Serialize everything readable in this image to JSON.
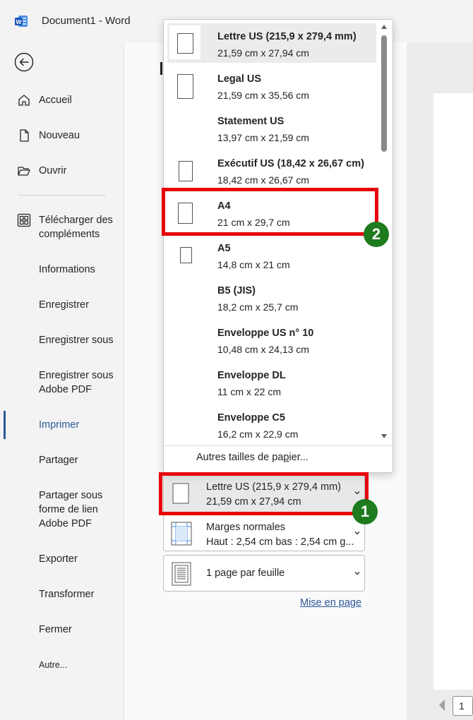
{
  "app": {
    "title": "Document1  -  Word",
    "logo_letter": "W"
  },
  "sidebar": {
    "items": [
      {
        "label": "Accueil",
        "icon": "home-icon"
      },
      {
        "label": "Nouveau",
        "icon": "new-document-icon"
      },
      {
        "label": "Ouvrir",
        "icon": "folder-open-icon"
      },
      {
        "label": "Télécharger des compléments",
        "icon": "add-ins-icon"
      },
      {
        "label": "Informations"
      },
      {
        "label": "Enregistrer"
      },
      {
        "label": "Enregistrer sous"
      },
      {
        "label": "Enregistrer sous Adobe PDF"
      },
      {
        "label": "Imprimer",
        "active": true
      },
      {
        "label": "Partager"
      },
      {
        "label": "Partager sous forme de lien Adobe PDF"
      },
      {
        "label": "Exporter"
      },
      {
        "label": "Transformer"
      },
      {
        "label": "Fermer"
      },
      {
        "label": "Autre..."
      }
    ]
  },
  "paper_dropdown": {
    "items": [
      {
        "name": "Lettre US (215,9 x 279,4 mm)",
        "dims": "21,59 cm x 27,94 cm",
        "selected": true
      },
      {
        "name": "Legal US",
        "dims": "21,59 cm x 35,56 cm"
      },
      {
        "name": "Statement US",
        "dims": "13,97 cm x 21,59 cm"
      },
      {
        "name": "Exécutif US (18,42 x 26,67 cm)",
        "dims": "18,42 cm x 26,67 cm"
      },
      {
        "name": "A4",
        "dims": "21 cm x 29,7 cm"
      },
      {
        "name": "A5",
        "dims": "14,8 cm x 21 cm"
      },
      {
        "name": "B5 (JIS)",
        "dims": "18,2 cm x 25,7 cm"
      },
      {
        "name": "Enveloppe US n° 10",
        "dims": "10,48 cm x 24,13 cm"
      },
      {
        "name": "Enveloppe DL",
        "dims": "11 cm x 22 cm"
      },
      {
        "name": "Enveloppe C5",
        "dims": "16,2 cm x 22,9 cm"
      }
    ],
    "footer_pre": "Autres tailles de pa",
    "footer_ul": "p",
    "footer_post": "ier..."
  },
  "settings": {
    "paper": {
      "line1": "Lettre US (215,9 x 279,4 mm)",
      "line2": "21,59 cm x 27,94 cm"
    },
    "margins": {
      "line1": "Marges normales",
      "line2": "Haut : 2,54 cm bas : 2,54 cm g..."
    },
    "pages_per_sheet": {
      "line1": "1 page par feuille"
    },
    "page_setup_link": "Mise en page"
  },
  "preview": {
    "page_number": "1"
  },
  "annotations": {
    "badge1": "1",
    "badge2": "2",
    "color": "#e8000b",
    "badge_color": "#1e7b1e"
  }
}
